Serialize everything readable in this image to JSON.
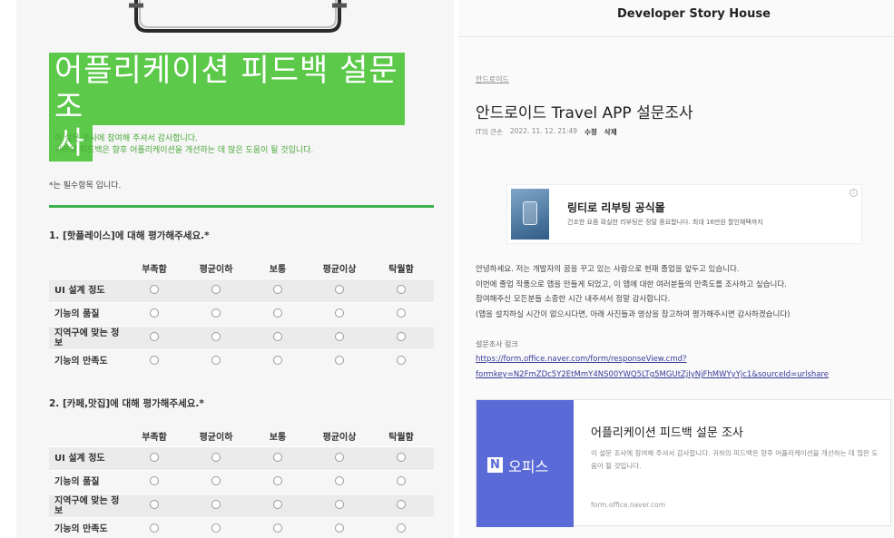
{
  "survey": {
    "title_line1": "어플리케이션 피드백 설문 조",
    "title_line2": "사",
    "intro_line1": "이 설문 조사에 참여해 주셔서 감사합니다.",
    "intro_line2": "귀하의 피드백은 향후 어플리케이션을 개선하는 데 많은 도움이 될 것입니다.",
    "required_note": "*는 필수항목 입니다.",
    "columns": [
      "부족함",
      "평균이하",
      "보통",
      "평균이상",
      "탁월함"
    ],
    "questions": [
      {
        "title": "1. [핫플레이스]에 대해 평가해주세요.*",
        "rows": [
          "UI 설계 정도",
          "기능의 품질",
          "지역구에 맞는 정보",
          "기능의 만족도"
        ]
      },
      {
        "title": "2. [카페,맛집]에 대해 평가해주세요.*",
        "rows": [
          "UI 설계 정도",
          "기능의 품질",
          "지역구에 맞는 정보",
          "기능의 만족도"
        ]
      }
    ]
  },
  "blog": {
    "name": "Developer Story House",
    "category": "안드로이드",
    "post_title": "안드로이드 Travel APP 설문조사",
    "meta": {
      "author": "IT의 큰손",
      "datetime": "2022. 11. 12. 21:49",
      "edit": "수정",
      "delete": "삭제"
    },
    "ad": {
      "title": "링티로 리부팅 공식몰",
      "desc": "건조한 요즘 확실한 리부팅은 정말 중요합니다. 최대 16만원 할인혜택까지"
    },
    "body_lines": [
      "안녕하세요. 저는 개발자의 꿈을 꾸고 있는 사람으로 현재 졸업을 앞두고 있습니다.",
      "이번에 졸업 작품으로 앱을 만들게 되었고, 이 앱에 대한 여러분들의 만족도를 조사하고 싶습니다.",
      "참여해주신 모든분들 소중한 시간 내주셔서 정말 감사합니다.",
      "(앱을 설치하실 시간이 없으시다면, 아래 사진들과 영상을 참고하여 평가해주시면 감사하겠습니다)"
    ],
    "link_label": "설문조사 링크",
    "link_line1": "https://form.office.naver.com/form/responseView.cmd?",
    "link_line2": "formkey=N2FmZDc5Y2EtMmY4NS00YWQ5LTg5MGUtZjIyNjFhMWYyYjc1&sourceId=urlshare",
    "card": {
      "logo_letter": "N",
      "logo_text": "오피스",
      "title": "어플리케이션 피드백 설문 조사",
      "desc": "이 설문 조사에 참여해 주셔서 감사합니다. 귀하의 피드백은 향후 어플리케이션을 개선하는 데 많은 도움이 될 것입니다.",
      "domain": "form.office.naver.com"
    }
  },
  "colors": {
    "accent_green": "#5cc94a",
    "rule_green": "#3cb04a",
    "office_blue": "#5a6ad6",
    "link": "#3a3a9a"
  }
}
